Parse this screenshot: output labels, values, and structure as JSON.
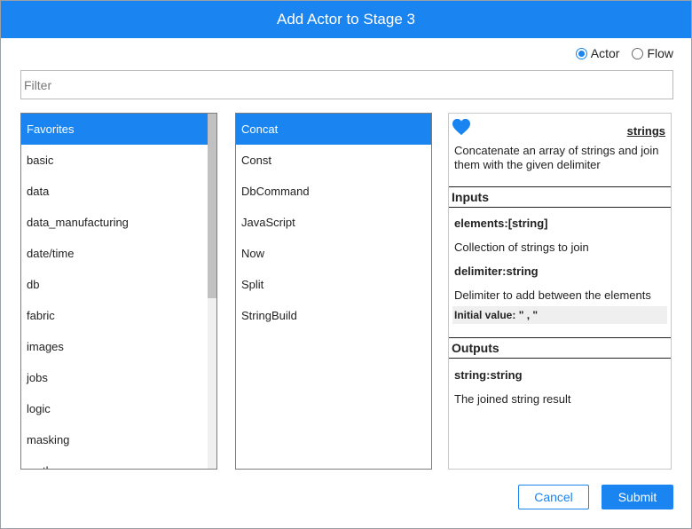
{
  "dialog": {
    "title": "Add Actor to Stage 3"
  },
  "mode": {
    "options": [
      "Actor",
      "Flow"
    ],
    "selected": "Actor"
  },
  "filter": {
    "placeholder": "Filter",
    "value": ""
  },
  "categories": {
    "items": [
      "Favorites",
      "basic",
      "data",
      "data_manufacturing",
      "date/time",
      "db",
      "fabric",
      "images",
      "jobs",
      "logic",
      "masking",
      "math"
    ],
    "selected": "Favorites"
  },
  "actors": {
    "items": [
      "Concat",
      "Const",
      "DbCommand",
      "JavaScript",
      "Now",
      "Split",
      "StringBuild"
    ],
    "selected": "Concat"
  },
  "details": {
    "favorite_icon": "heart-icon",
    "name": "strings",
    "description": "Concatenate an array of strings and join them with the given delimiter",
    "inputs_heading": "Inputs",
    "inputs": [
      {
        "signature": "elements:[string]",
        "description": "Collection of strings to join"
      },
      {
        "signature": "delimiter:string",
        "description": "Delimiter to add between the elements",
        "initial_label": "Initial value:",
        "initial_value": "\" , \""
      }
    ],
    "outputs_heading": "Outputs",
    "outputs": [
      {
        "signature": "string:string",
        "description": "The joined string result"
      }
    ]
  },
  "buttons": {
    "cancel": "Cancel",
    "submit": "Submit"
  },
  "colors": {
    "accent": "#1a84f0"
  }
}
